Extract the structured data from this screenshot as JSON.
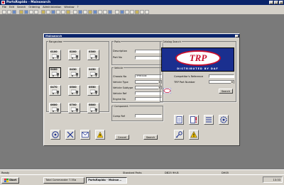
{
  "window": {
    "title": "PartsRapido - Mainsearch"
  },
  "menu": [
    "File",
    "Edit",
    "Search",
    "Ordering",
    "Administration",
    "Window",
    "?"
  ],
  "dialog": {
    "title": "Mainsearch",
    "rangeview": {
      "label": "Rangeview",
      "vehicles": [
        {
          "code": "0100"
        },
        {
          "code": "0200"
        },
        {
          "code": "0300"
        },
        {
          "code": "0400"
        },
        {
          "code": "0430"
        },
        {
          "code": "0450"
        },
        {
          "code": "0470"
        },
        {
          "code": "0500"
        },
        {
          "code": "0550"
        },
        {
          "code": "0600"
        },
        {
          "code": "0700"
        },
        {
          "code": "0800"
        }
      ]
    },
    "parts": {
      "label": "Parts",
      "description_label": "Description",
      "partno_label": "Part No"
    },
    "vehicle": {
      "label": "Vehicle",
      "chassis_label": "Chassis No",
      "chassis_value": "3F3P2449",
      "type_label": "Vehicle Type",
      "subtype_label": "Vehicle Subtype",
      "ref_label": "Vehicle Ref",
      "engine_label": "Engine No"
    },
    "component": {
      "label": "Component",
      "comp_ref_label": "Comp Ref"
    },
    "catalog": {
      "label": "Catalog Search",
      "logo_text": "TRP",
      "logo_sub": "DISTRIBUTED BY DAF",
      "competitor_label": "Competitor's Reference",
      "trp_partno_label": "TRP Part Number",
      "search_label": "Search"
    },
    "cancel_label": "Cancel",
    "search_label": "Search"
  },
  "status": {
    "left": "Ready",
    "mid": "Standard Parts",
    "db": "DB25 9H-B",
    "right": "DH05"
  },
  "taskbar": {
    "start": "Start",
    "tasks": [
      "Total Commander 7.55a",
      "PartsRapido - Mainse..."
    ],
    "clock": "13:33"
  }
}
